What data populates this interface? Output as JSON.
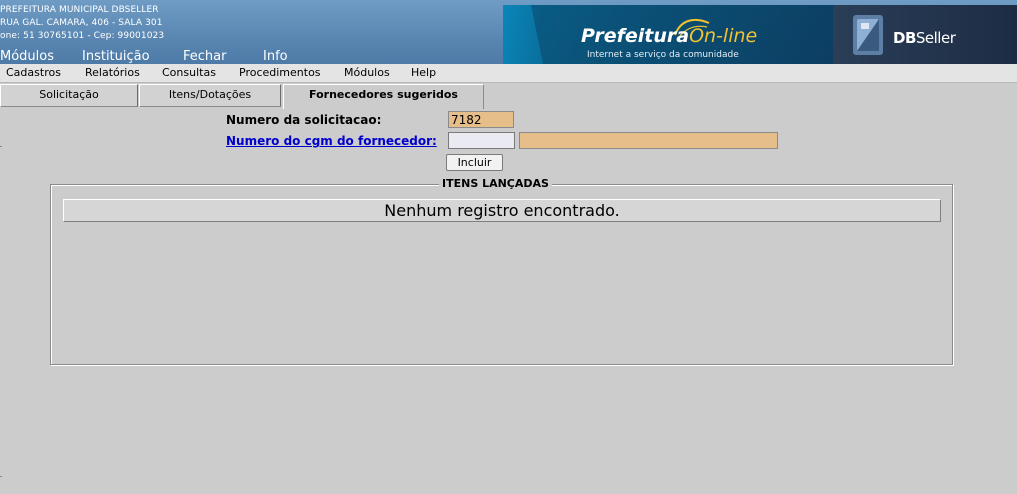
{
  "header": {
    "org_name": "PREFEITURA MUNICIPAL DBSELLER",
    "org_address": "RUA GAL. CAMARA, 406 - SALA 301",
    "org_phone": "one: 51 30765101  -  Cep: 99001023",
    "top_menu": [
      {
        "label": "Módulos"
      },
      {
        "label": "Instituição"
      },
      {
        "label": "Fechar"
      },
      {
        "label": "Info"
      }
    ],
    "logo": {
      "brand_main": "Prefeitura",
      "brand_accent": "On-line",
      "tagline": "Internet a serviço da comunidade",
      "accent_color": "#f2c230"
    },
    "vendor": {
      "name_bold": "DB",
      "name_rest": "Seller"
    }
  },
  "menubar": [
    {
      "label": "Cadastros"
    },
    {
      "label": "Relatórios"
    },
    {
      "label": "Consultas"
    },
    {
      "label": "Procedimentos"
    },
    {
      "label": "Módulos"
    },
    {
      "label": "Help"
    }
  ],
  "tabs": [
    {
      "label": "Solicitação",
      "active": false
    },
    {
      "label": "Itens/Dotações",
      "active": false
    },
    {
      "label": "Fornecedores sugeridos",
      "active": true
    }
  ],
  "form": {
    "solicitacao_label": "Numero da solicitacao:",
    "solicitacao_value": "7182",
    "cgm_label": "Numero do cgm do fornecedor:",
    "cgm_value": "",
    "cgm_name_value": "",
    "submit_label": "Incluir"
  },
  "items_section": {
    "legend": "ITENS LANÇADAS",
    "empty_message": "Nenhum registro encontrado."
  }
}
